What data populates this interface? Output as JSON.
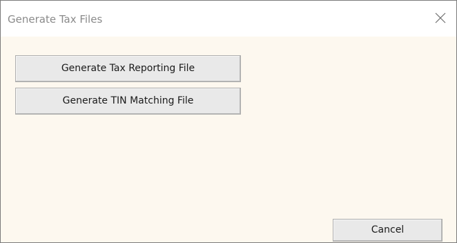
{
  "window": {
    "title": "Generate Tax Files"
  },
  "buttons": {
    "tax_reporting": "Generate Tax Reporting File",
    "tin_matching": "Generate TIN Matching File",
    "cancel": "Cancel"
  },
  "icons": {
    "close": "close-icon"
  },
  "colors": {
    "content_background": "#fdf8ef",
    "button_face": "#e9e9e9",
    "title_text": "#8a8a8a"
  }
}
